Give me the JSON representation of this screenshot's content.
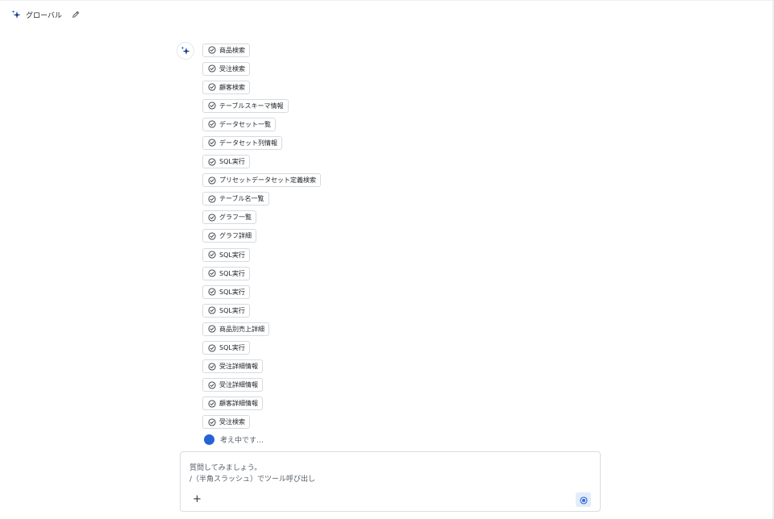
{
  "header": {
    "title": "グローバル",
    "icon": "sparkle-icon",
    "edit_icon": "pencil-icon"
  },
  "assistant": {
    "avatar_icon": "sparkle-icon"
  },
  "tool_calls": [
    {
      "label": "商品検索",
      "icon": "check-circle-icon"
    },
    {
      "label": "受注検索",
      "icon": "check-circle-icon"
    },
    {
      "label": "顧客検索",
      "icon": "check-circle-icon"
    },
    {
      "label": "テーブルスキーマ情報",
      "icon": "check-circle-icon"
    },
    {
      "label": "データセット一覧",
      "icon": "check-circle-icon"
    },
    {
      "label": "データセット列情報",
      "icon": "check-circle-icon"
    },
    {
      "label": "SQL実行",
      "icon": "check-circle-icon"
    },
    {
      "label": "プリセットデータセット定義検索",
      "icon": "check-circle-icon"
    },
    {
      "label": "テーブル名一覧",
      "icon": "check-circle-icon"
    },
    {
      "label": "グラフ一覧",
      "icon": "check-circle-icon"
    },
    {
      "label": "グラフ詳細",
      "icon": "check-circle-icon"
    },
    {
      "label": "SQL実行",
      "icon": "check-circle-icon"
    },
    {
      "label": "SQL実行",
      "icon": "check-circle-icon"
    },
    {
      "label": "SQL実行",
      "icon": "check-circle-icon"
    },
    {
      "label": "SQL実行",
      "icon": "check-circle-icon"
    },
    {
      "label": "商品別売上詳細",
      "icon": "check-circle-icon"
    },
    {
      "label": "SQL実行",
      "icon": "check-circle-icon"
    },
    {
      "label": "受注詳細情報",
      "icon": "check-circle-icon"
    },
    {
      "label": "受注詳細情報",
      "icon": "check-circle-icon"
    },
    {
      "label": "顧客詳細情報",
      "icon": "check-circle-icon"
    },
    {
      "label": "受注検索",
      "icon": "check-circle-icon"
    }
  ],
  "status": {
    "thinking_label": "考え中です…"
  },
  "composer": {
    "placeholder_line1": "質問してみましょう。",
    "placeholder_line2": "/（半角スラッシュ）でツール呼び出し",
    "add_label": "+",
    "stop_icon": "stop-icon"
  },
  "colors": {
    "accent": "#2463d6",
    "sparkle_dark": "#1e3a8a",
    "chip_border": "#d6dae0",
    "stop_button_bg": "#e3ecfa"
  }
}
